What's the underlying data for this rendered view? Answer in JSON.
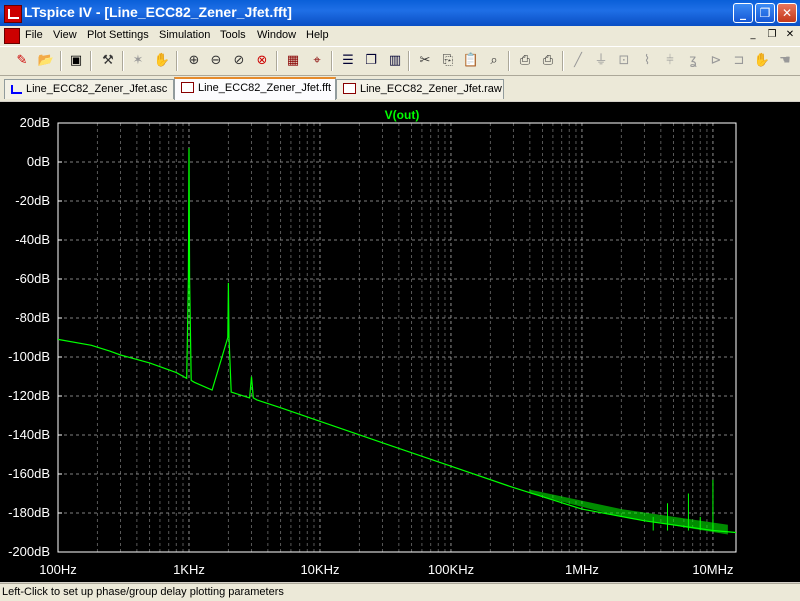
{
  "window": {
    "title": "LTspice IV - [Line_ECC82_Zener_Jfet.fft]",
    "buttons": {
      "minimize": "_",
      "restore": "❐",
      "close": "✕"
    }
  },
  "menu": {
    "items": [
      "File",
      "View",
      "Plot Settings",
      "Simulation",
      "Tools",
      "Window",
      "Help"
    ],
    "mdi_buttons": {
      "minimize": "_",
      "restore": "❐",
      "close": "✕"
    }
  },
  "toolbar": {
    "icons": [
      "new-schematic-icon",
      "open-icon",
      "save-icon",
      "control-panel-icon",
      "run-icon",
      "halt-icon",
      "zoom-in-icon",
      "zoom-out-icon",
      "zoom-fit-icon",
      "zoom-cancel-icon",
      "autorange-icon",
      "cursor-icon",
      "tile-horizontal-icon",
      "cascade-icon",
      "tile-vertical-icon",
      "cut-icon",
      "copy-icon",
      "paste-icon",
      "find-icon",
      "print-preview-icon",
      "print-icon",
      "wire-icon",
      "ground-icon",
      "label-icon",
      "resistor-icon",
      "capacitor-icon",
      "inductor-icon",
      "diode-icon",
      "component-icon",
      "move-icon",
      "drag-icon"
    ]
  },
  "tabs": [
    {
      "label": "Line_ECC82_Zener_Jfet.asc",
      "kind": "schematic",
      "active": false
    },
    {
      "label": "Line_ECC82_Zener_Jfet.fft",
      "kind": "fft",
      "active": true
    },
    {
      "label": "Line_ECC82_Zener_Jfet.raw",
      "kind": "waveform",
      "active": false
    }
  ],
  "status": "Left-Click to set up phase/group delay plotting parameters",
  "colors": {
    "trace": "#00ff00",
    "grid": "#a0a0a0",
    "axis_text": "#ffffff",
    "background": "#000000",
    "frame": "#ffffff"
  },
  "chart_data": {
    "type": "line",
    "title": "V(out)",
    "xscale": "log",
    "xlim": [
      100,
      15000000
    ],
    "ylim": [
      -200,
      20
    ],
    "xticks": [
      {
        "value": 100,
        "label": "100Hz"
      },
      {
        "value": 1000,
        "label": "1KHz"
      },
      {
        "value": 10000,
        "label": "10KHz"
      },
      {
        "value": 100000,
        "label": "100KHz"
      },
      {
        "value": 1000000,
        "label": "1MHz"
      },
      {
        "value": 10000000,
        "label": "10MHz"
      }
    ],
    "yticks": [
      {
        "value": 20,
        "label": "20dB"
      },
      {
        "value": 0,
        "label": "0dB"
      },
      {
        "value": -20,
        "label": "-20dB"
      },
      {
        "value": -40,
        "label": "-40dB"
      },
      {
        "value": -60,
        "label": "-60dB"
      },
      {
        "value": -80,
        "label": "-80dB"
      },
      {
        "value": -100,
        "label": "-100dB"
      },
      {
        "value": -120,
        "label": "-120dB"
      },
      {
        "value": -140,
        "label": "-140dB"
      },
      {
        "value": -160,
        "label": "-160dB"
      },
      {
        "value": -180,
        "label": "-180dB"
      },
      {
        "value": -200,
        "label": "-200dB"
      }
    ],
    "grid": true,
    "series": [
      {
        "name": "V(out)",
        "x": [
          100,
          180,
          250,
          300,
          500,
          800,
          960,
          990,
          1000,
          1010,
          1040,
          1100,
          1500,
          1980,
          2000,
          2020,
          2100,
          2900,
          3000,
          3100,
          3300,
          5000,
          10000,
          30000,
          100000,
          300000,
          1000000,
          3000000,
          10000000,
          15000000
        ],
        "y": [
          -91,
          -94,
          -97,
          -99,
          -103,
          -108,
          -111,
          -60,
          7,
          -60,
          -112,
          -113,
          -117,
          -90,
          -62,
          -90,
          -118,
          -121,
          -110,
          -121,
          -122,
          -126,
          -133,
          -144,
          -156,
          -167,
          -178,
          -184,
          -189,
          -190
        ]
      }
    ],
    "noise_band": {
      "from_hz": 400000,
      "to_hz": 15000000,
      "upper_db": [
        -168,
        -178,
        -186
      ],
      "lower_db": [
        -170,
        -182,
        -191
      ],
      "at_hz": [
        400000,
        2000000,
        13000000
      ]
    },
    "spurs": [
      {
        "x": 3500000,
        "top": -182
      },
      {
        "x": 4500000,
        "top": -175
      },
      {
        "x": 6500000,
        "top": -170
      },
      {
        "x": 8000000,
        "top": -182
      },
      {
        "x": 10000000,
        "top": -163
      }
    ]
  }
}
